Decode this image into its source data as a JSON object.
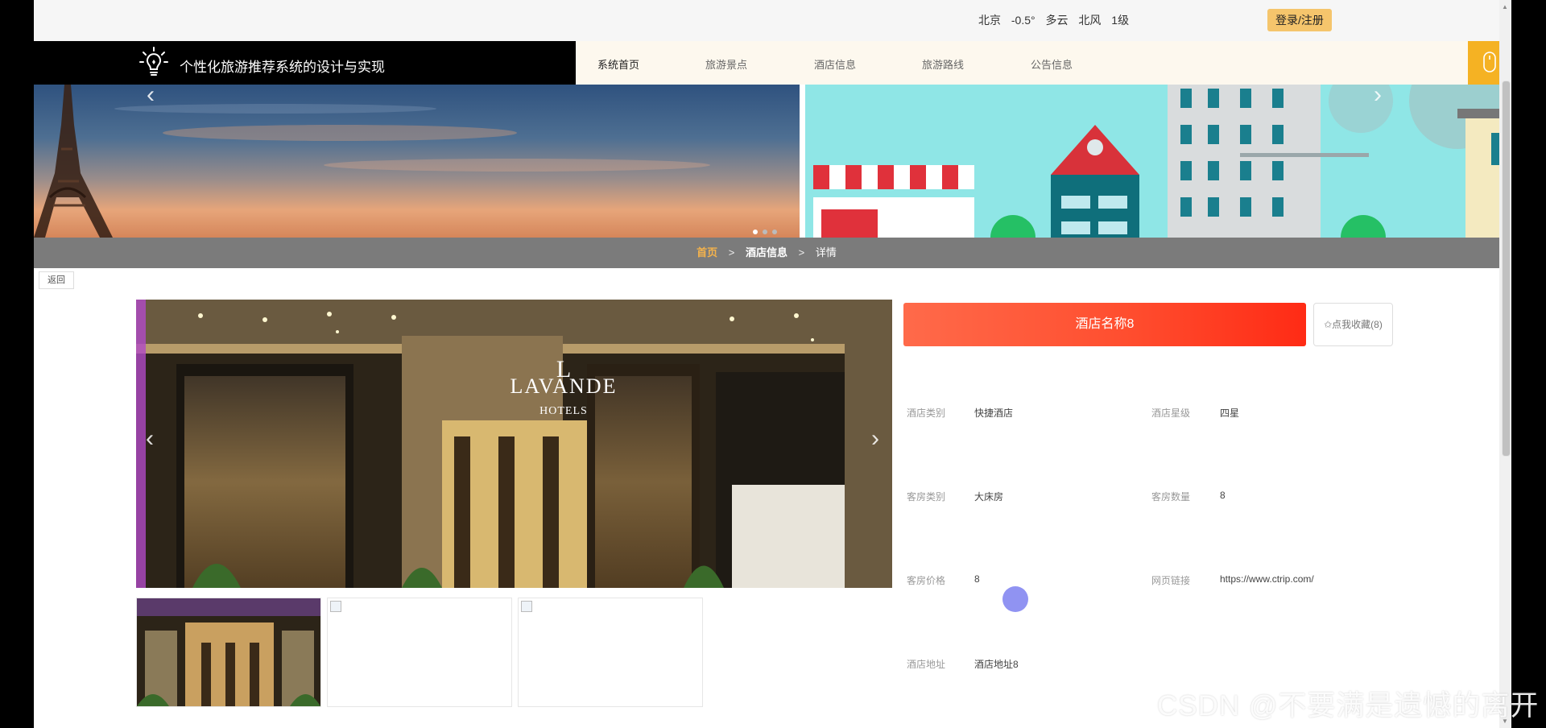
{
  "topbar": {
    "weather": {
      "city": "北京",
      "temp": "-0.5°",
      "condition": "多云",
      "wind": "北风",
      "level": "1级"
    },
    "login_label": "登录/注册"
  },
  "header": {
    "site_title": "个性化旅游推荐系统的设计与实现",
    "nav": [
      {
        "label": "系统首页"
      },
      {
        "label": "旅游景点"
      },
      {
        "label": "酒店信息"
      },
      {
        "label": "旅游路线"
      },
      {
        "label": "公告信息"
      }
    ]
  },
  "breadcrumb": {
    "home": "首页",
    "section": "酒店信息",
    "current": "详情",
    "separator": ">"
  },
  "back_label": "返回",
  "hotel": {
    "name": "酒店名称8",
    "favorite_label": "✩点我收藏(8)",
    "fields": [
      {
        "label": "酒店类别",
        "value": "快捷酒店"
      },
      {
        "label": "酒店星级",
        "value": "四星"
      },
      {
        "label": "客房类别",
        "value": "大床房"
      },
      {
        "label": "客房数量",
        "value": "8"
      },
      {
        "label": "客房价格",
        "value": "8"
      },
      {
        "label": "网页链接",
        "value": "https://www.ctrip.com/"
      },
      {
        "label": "酒店地址",
        "value": "酒店地址8"
      }
    ]
  },
  "gallery": {
    "sign_line1": "LAVANDE",
    "sign_line2": "HOTELS"
  },
  "watermark": "CSDN @不要满是遗憾的离开",
  "colors": {
    "accent_orange": "#f5b223",
    "title_red": "#ff4e2f",
    "breadcrumb_bg": "#7b7b7b",
    "crumb_home": "#f5b34c"
  }
}
